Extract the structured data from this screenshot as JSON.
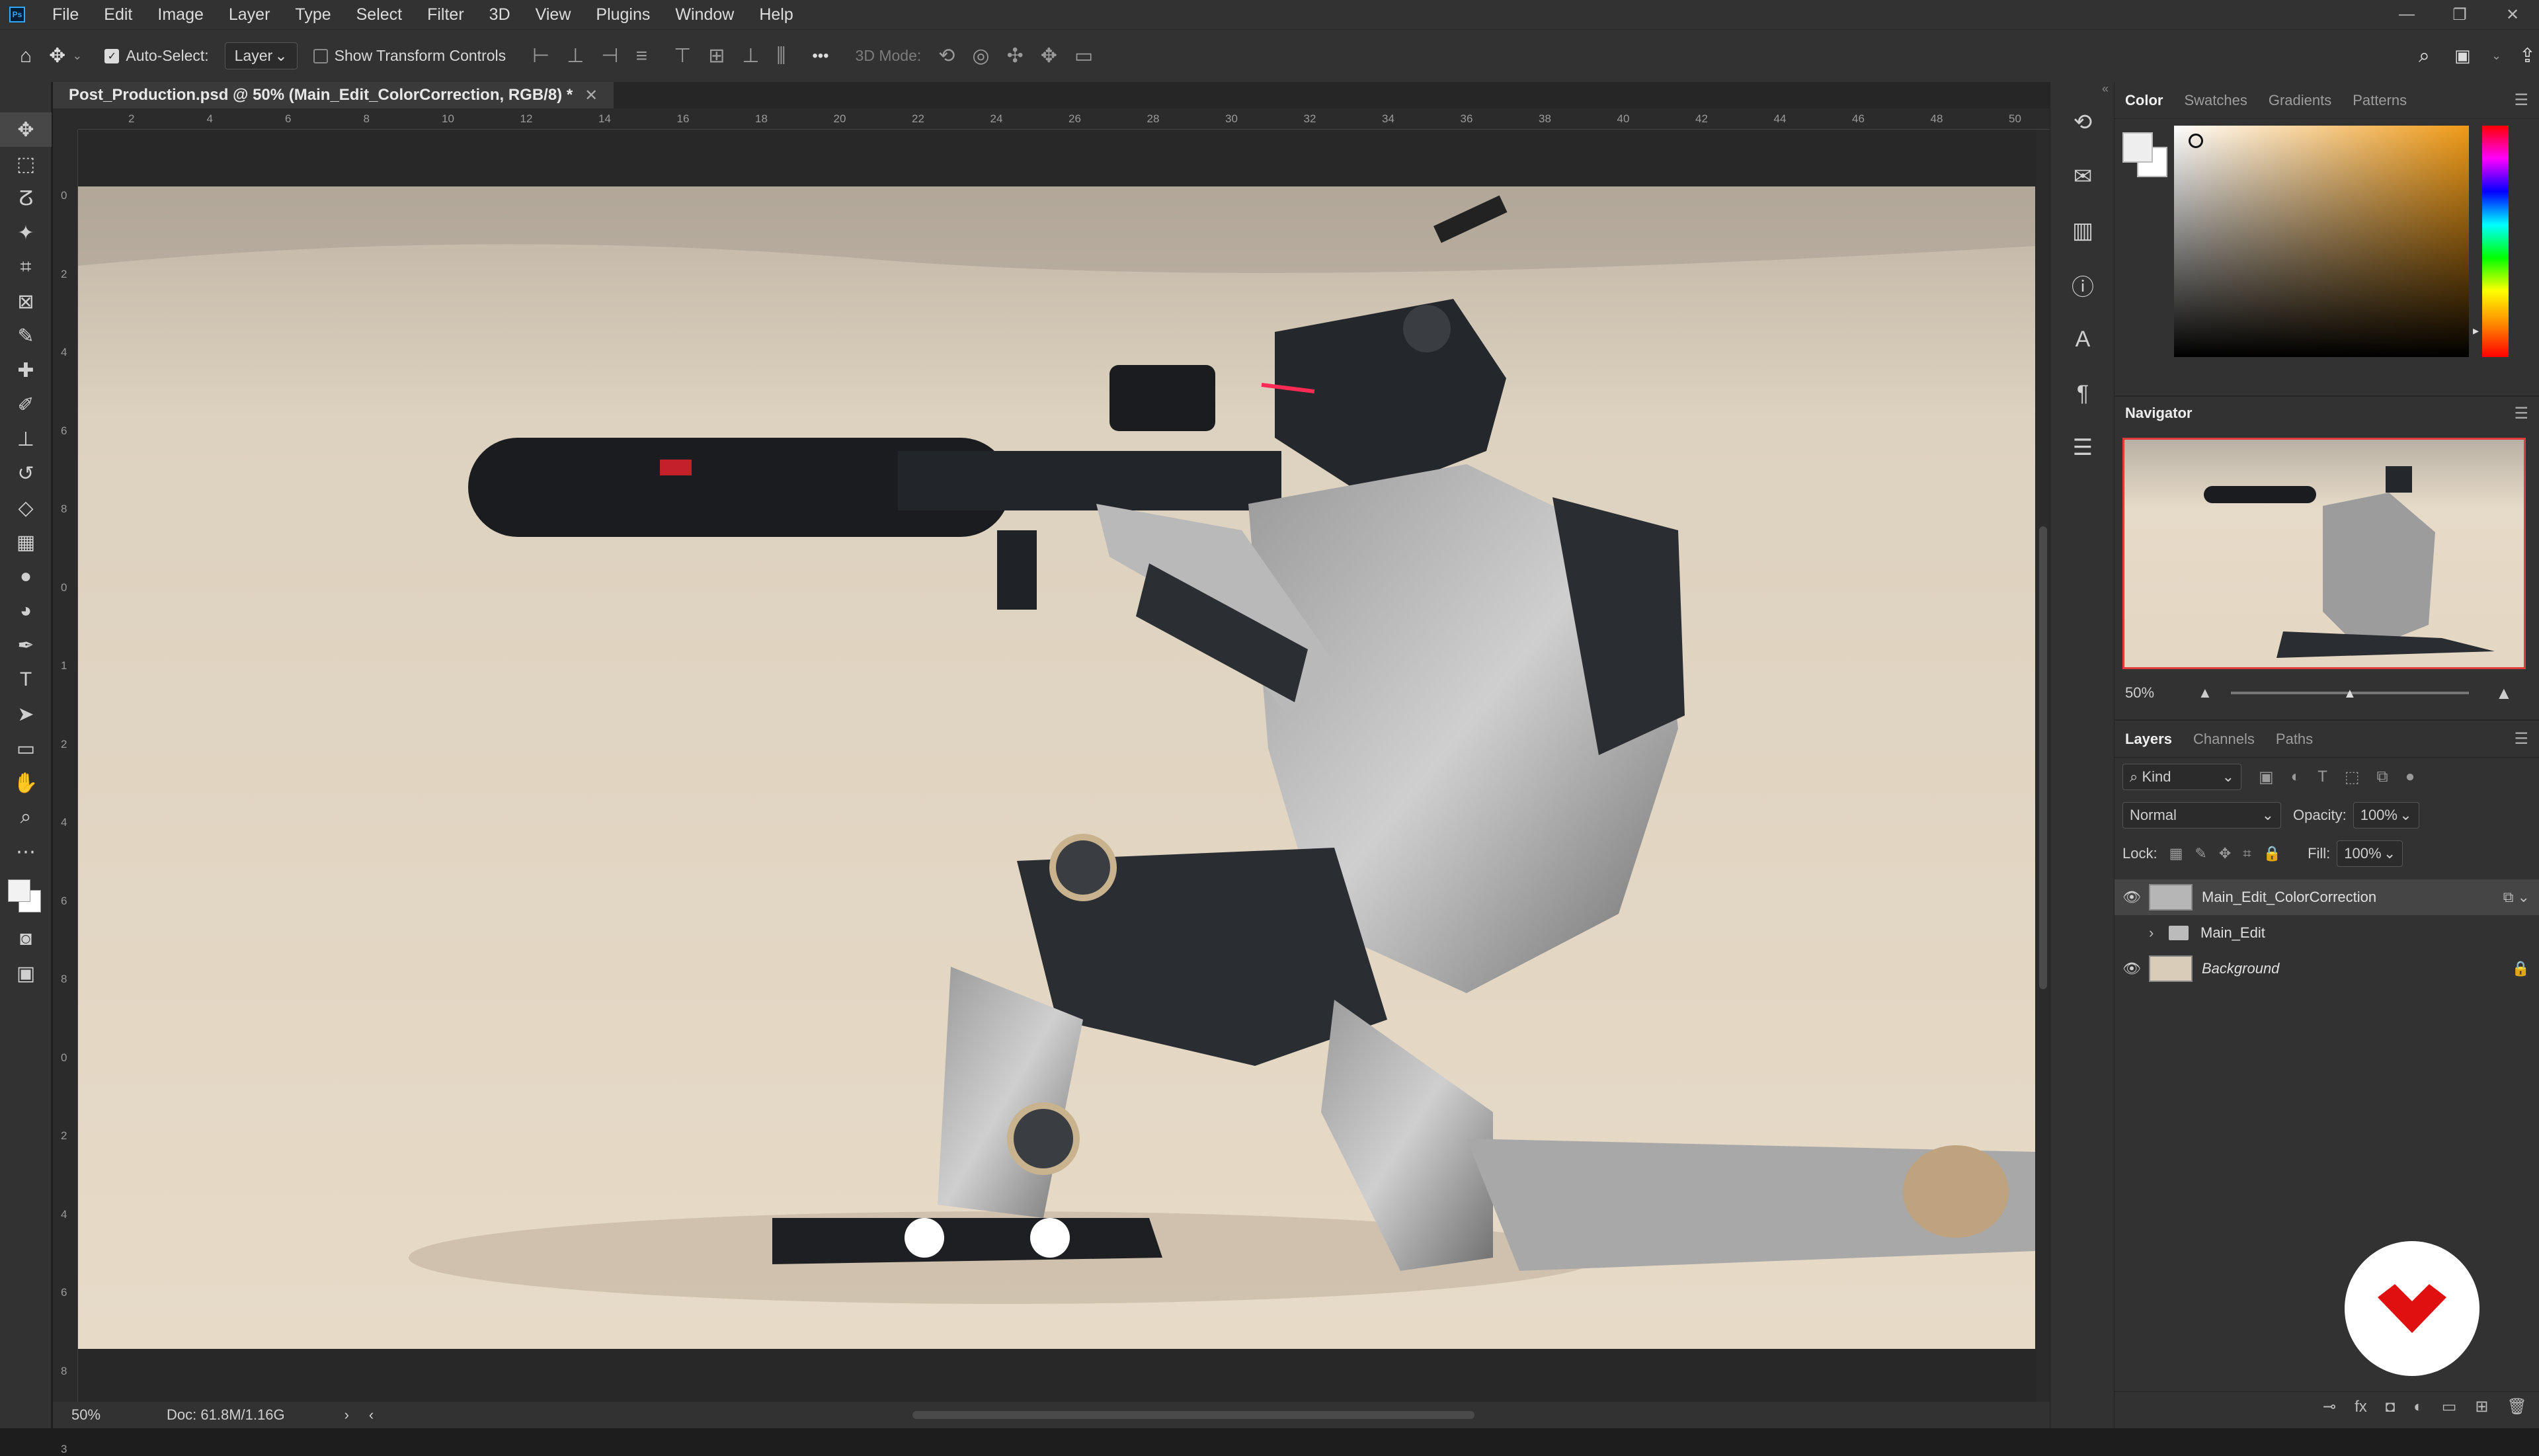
{
  "menubar": {
    "logo": "Ps",
    "items": [
      "File",
      "Edit",
      "Image",
      "Layer",
      "Type",
      "Select",
      "Filter",
      "3D",
      "View",
      "Plugins",
      "Window",
      "Help"
    ],
    "win_controls": [
      "—",
      "❐",
      "✕"
    ]
  },
  "options": {
    "auto_select_label": "Auto-Select:",
    "auto_select_value": "Layer",
    "transform_label": "Show Transform Controls",
    "mode_label": "3D Mode:",
    "more": "•••"
  },
  "document": {
    "tab_title": "Post_Production.psd @ 50% (Main_Edit_ColorCorrection, RGB/8) *",
    "close": "✕"
  },
  "ruler": {
    "h_ticks": [
      "2",
      "4",
      "6",
      "8",
      "10",
      "12",
      "14",
      "16",
      "18",
      "20",
      "22",
      "24",
      "26",
      "28",
      "30",
      "32",
      "34",
      "36",
      "38",
      "40",
      "42",
      "44",
      "46",
      "48",
      "50"
    ],
    "v_ticks": [
      "0",
      "2",
      "4",
      "6",
      "8",
      "0",
      "1",
      "2",
      "4",
      "6",
      "8",
      "0",
      "2",
      "4",
      "6",
      "8",
      "3"
    ]
  },
  "status": {
    "zoom": "50%",
    "doc": "Doc: 61.8M/1.16G",
    "arrow": "›",
    "left": "‹",
    "right": "›"
  },
  "color_panel": {
    "tabs": [
      "Color",
      "Swatches",
      "Gradients",
      "Patterns"
    ],
    "active_tab": "Color"
  },
  "navigator": {
    "title": "Navigator",
    "zoom": "50%"
  },
  "layers_panel": {
    "tabs": [
      "Layers",
      "Channels",
      "Paths"
    ],
    "active_tab": "Layers",
    "filter": "Kind",
    "blend_mode": "Normal",
    "opacity_label": "Opacity:",
    "opacity": "100%",
    "lock_label": "Lock:",
    "fill_label": "Fill:",
    "fill": "100%",
    "layers": [
      {
        "name": "Main_Edit_ColorCorrection",
        "selected": true
      },
      {
        "name": "Main_Edit",
        "type": "group"
      },
      {
        "name": "Background",
        "locked": true
      }
    ]
  },
  "colors": {
    "accent": "#e03a3a",
    "panel": "#323232",
    "workspace": "#282828"
  }
}
